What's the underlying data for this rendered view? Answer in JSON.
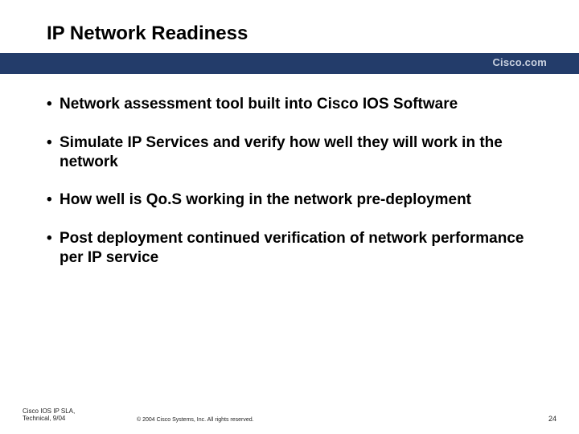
{
  "title": "IP Network Readiness",
  "brand": "Cisco.com",
  "bullets": [
    "Network assessment tool built into Cisco IOS Software",
    "Simulate IP Services and verify how well they will work in the network",
    "How well is Qo.S working in the network pre-deployment",
    "Post deployment continued verification of network performance per IP service"
  ],
  "footer": {
    "left_line1": "Cisco IOS IP SLA,",
    "left_line2": "Technical, 9/04",
    "center": "© 2004 Cisco Systems, Inc. All rights reserved.",
    "page_number": "24"
  }
}
